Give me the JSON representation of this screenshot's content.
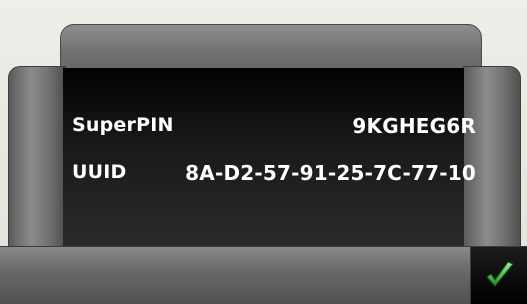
{
  "info": {
    "rows": [
      {
        "label": "SuperPIN",
        "value": "9KGHEG6R"
      },
      {
        "label": "UUID",
        "value": "8A-D2-57-91-25-7C-77-10"
      }
    ]
  },
  "controls": {
    "ok_icon": "checkmark-icon",
    "ok_color": "#3db23d"
  }
}
